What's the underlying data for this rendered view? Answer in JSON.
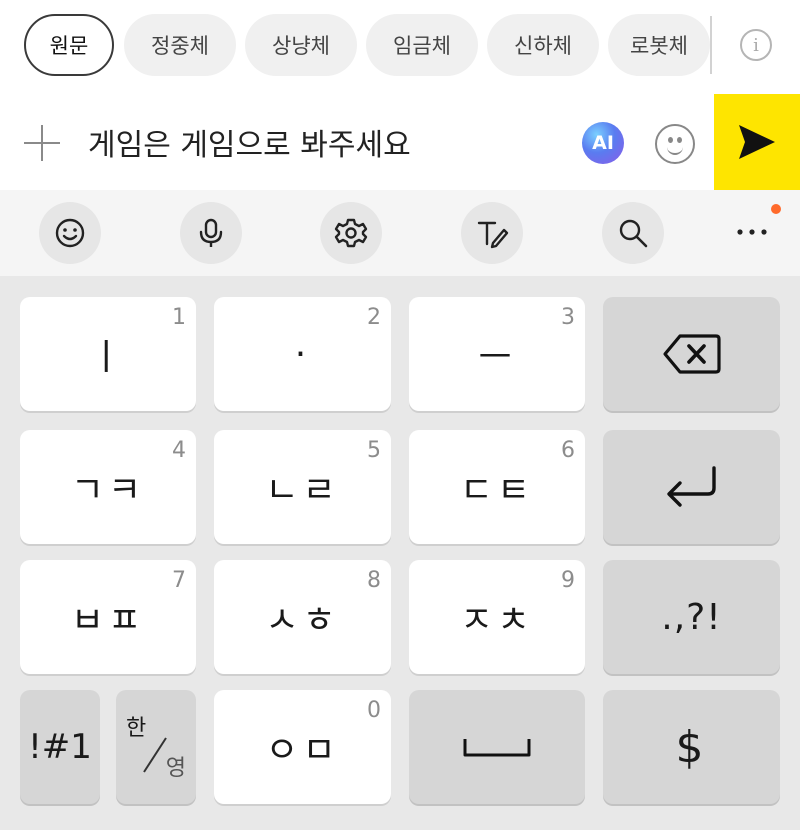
{
  "tone_chips": [
    {
      "label": "원문",
      "active": true
    },
    {
      "label": "정중체",
      "active": false
    },
    {
      "label": "상냥체",
      "active": false
    },
    {
      "label": "임금체",
      "active": false
    },
    {
      "label": "신하체",
      "active": false
    },
    {
      "label": "로봇체",
      "active": false
    }
  ],
  "info_icon_glyph": "i",
  "input": {
    "text": "게임은 게임으로 봐주세요",
    "ai_label": "AI"
  },
  "keyboard": {
    "rows": [
      [
        {
          "label": "ㅣ",
          "num": "1"
        },
        {
          "label": "·",
          "num": "2"
        },
        {
          "label": "ㅡ",
          "num": "3"
        }
      ],
      [
        {
          "label": "ㄱㅋ",
          "num": "4"
        },
        {
          "label": "ㄴㄹ",
          "num": "5"
        },
        {
          "label": "ㄷㅌ",
          "num": "6"
        }
      ],
      [
        {
          "label": "ㅂㅍ",
          "num": "7"
        },
        {
          "label": "ㅅㅎ",
          "num": "8"
        },
        {
          "label": "ㅈㅊ",
          "num": "9"
        }
      ]
    ],
    "zero_key": {
      "label": "ㅇㅁ",
      "num": "0"
    },
    "symbols_key": "!#1",
    "lang_key": {
      "top": "한",
      "bottom": "영"
    },
    "punct_key": ".,?!",
    "currency_key": "$"
  },
  "icons": {
    "send": "send-icon",
    "toolbar": [
      "emoji-icon",
      "mic-icon",
      "settings-icon",
      "handwriting-icon",
      "search-icon",
      "more-icon"
    ],
    "backspace": "backspace-icon",
    "enter": "enter-icon",
    "space": "space-icon"
  },
  "colors": {
    "send_bg": "#fee500",
    "notif_dot": "#ff6a2b",
    "keyboard_bg": "#e8e8e8",
    "key_bg": "#ffffff",
    "key_gray_bg": "#d6d6d6"
  }
}
